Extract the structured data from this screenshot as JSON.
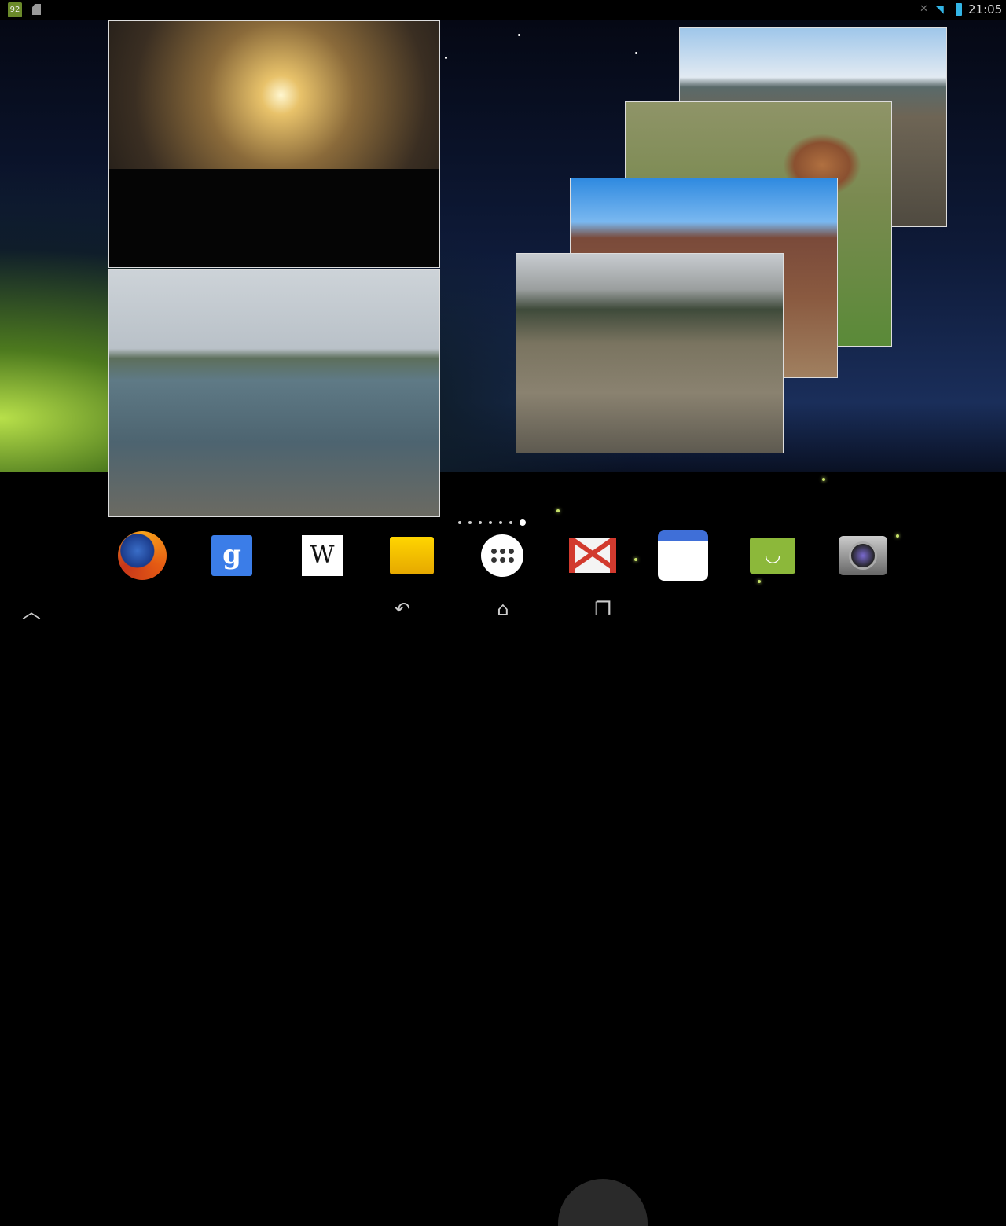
{
  "status_bar": {
    "battery_left": "92",
    "clock": "21:05",
    "icons": [
      "battery-icon",
      "sd-card-icon",
      "mute-icon",
      "wifi-icon",
      "battery-icon"
    ]
  },
  "widget_photos": [
    "sunset-lamp-post",
    "coastal-island",
    "sky-plateau",
    "horse-field",
    "red-hills",
    "waterfall"
  ],
  "page_indicator": {
    "pages": 7,
    "current": 7
  },
  "dock": [
    {
      "name": "firefox",
      "icon": "firefox-icon"
    },
    {
      "name": "google",
      "icon": "google-icon",
      "glyph": "g"
    },
    {
      "name": "wikipedia",
      "icon": "wikipedia-icon",
      "glyph": "W"
    },
    {
      "name": "file-manager",
      "icon": "folder-icon"
    },
    {
      "name": "all-apps",
      "icon": "app-drawer-icon"
    },
    {
      "name": "gmail",
      "icon": "gmail-icon"
    },
    {
      "name": "calendar",
      "icon": "calendar-icon"
    },
    {
      "name": "messaging",
      "icon": "messaging-icon",
      "glyph": "◡"
    },
    {
      "name": "camera",
      "icon": "camera-icon"
    }
  ],
  "nav_bar": {
    "up": "︿",
    "back": "↶",
    "home": "⌂",
    "recents": "❐"
  }
}
